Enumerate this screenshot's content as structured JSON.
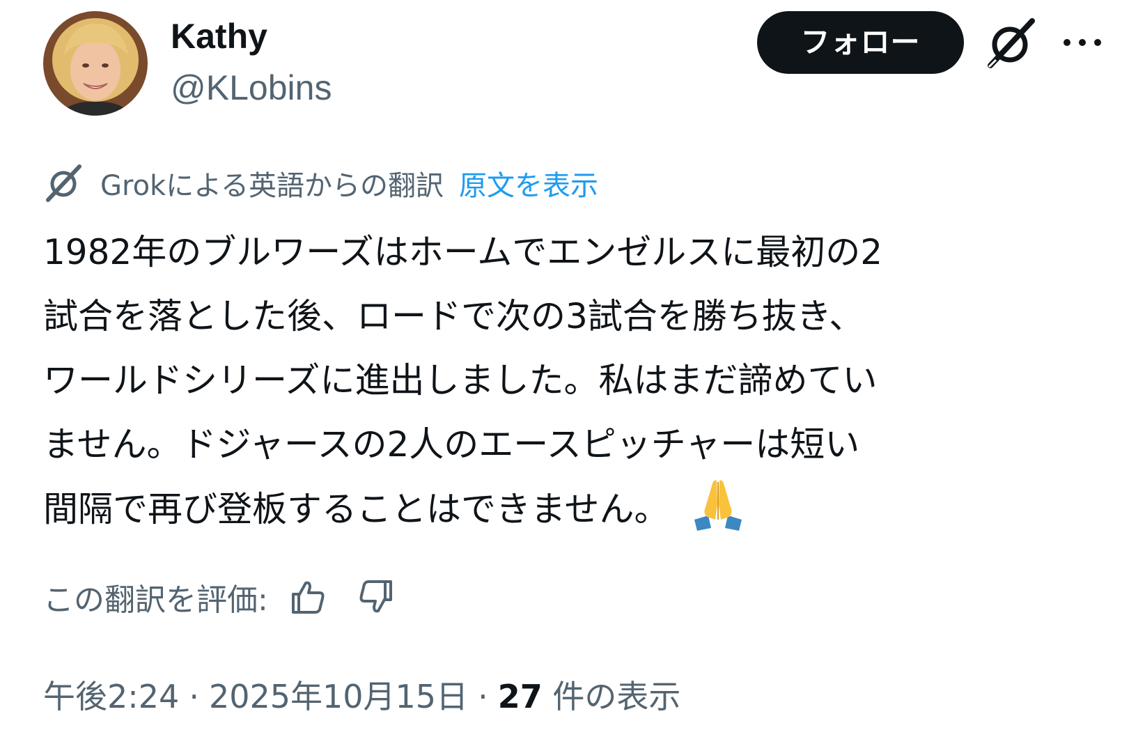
{
  "author": {
    "display_name": "Kathy",
    "handle": "@KLobins",
    "avatar_icon": "avatar-photo"
  },
  "header": {
    "follow_label": "フォロー",
    "grok_icon": "grok-icon",
    "more_icon": "more-icon"
  },
  "translation": {
    "notice": "Grokによる英語からの翻訳",
    "show_original": "原文を表示"
  },
  "tweet": {
    "lines": [
      "1982年のブルワーズはホームでエンゼルスに最初の2",
      "試合を落とした後、ロードで次の3試合を勝ち抜き、",
      "ワールドシリーズに進出しました。私はまだ諦めてい",
      "ません。ドジャースの2人のエースピッチャーは短い",
      "間隔で再び登板することはできません。"
    ],
    "emoji": "folded-hands-emoji"
  },
  "rating": {
    "label": "この翻訳を評価:",
    "up_icon": "thumb-up-icon",
    "down_icon": "thumb-down-icon"
  },
  "meta": {
    "time": "午後2:24",
    "separator": "·",
    "date": "2025年10月15日",
    "views_count": "27",
    "views_label": "件の表示"
  },
  "colors": {
    "text_primary": "#0f1419",
    "text_secondary": "#536471",
    "link": "#1d9bf0",
    "button_bg": "#0f1419",
    "button_text": "#ffffff"
  }
}
